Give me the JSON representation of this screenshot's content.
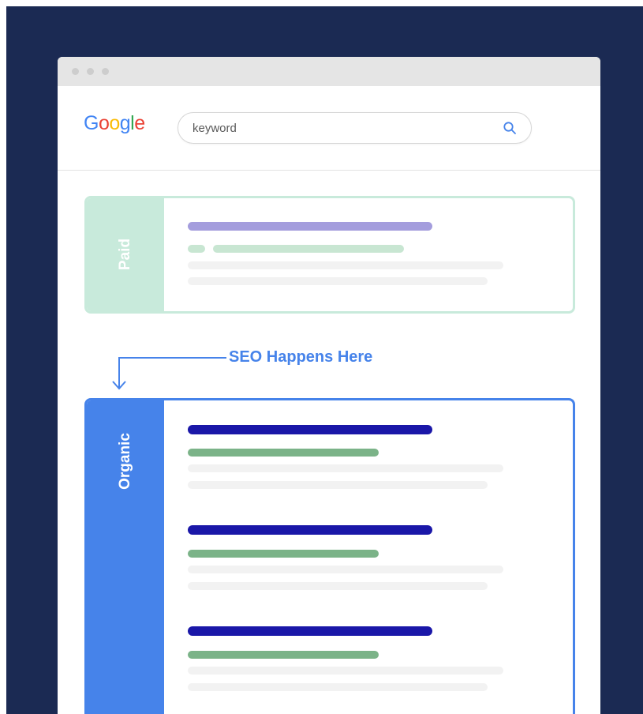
{
  "logo": {
    "letters": [
      {
        "ch": "G",
        "color": "#4285F4"
      },
      {
        "ch": "o",
        "color": "#EA4335"
      },
      {
        "ch": "o",
        "color": "#FBBC05"
      },
      {
        "ch": "g",
        "color": "#4285F4"
      },
      {
        "ch": "l",
        "color": "#34A853"
      },
      {
        "ch": "e",
        "color": "#EA4335"
      }
    ]
  },
  "search": {
    "value": "keyword",
    "icon": "search-icon"
  },
  "paid": {
    "label": "Paid",
    "color": "#c8eadb"
  },
  "callout": {
    "text": "SEO Happens Here",
    "color": "#4683ea"
  },
  "organic": {
    "label": "Organic",
    "color": "#4683ea",
    "result_count": 3
  },
  "colors": {
    "background": "#1b2a53",
    "paid_title": "#a49ddd",
    "organic_title": "#1a17a8",
    "organic_url": "#7bb388"
  }
}
